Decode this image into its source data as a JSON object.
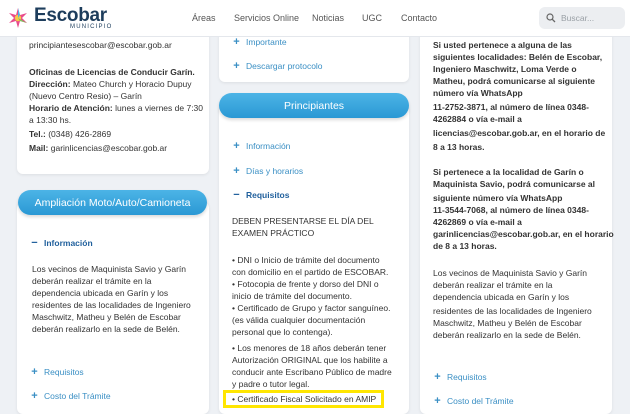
{
  "header": {
    "logo_name": "Escobar",
    "logo_sub": "MUNICIPIO",
    "nav": [
      "Áreas",
      "Servicios Online",
      "Noticias",
      "UGC",
      "Contacto"
    ],
    "search_placeholder": "Buscar..."
  },
  "left_card_top": {
    "email_partial": "principiantesescobar@escobar.gob.ar",
    "office_title": "Oficinas de Licencias de Conducir Garín.",
    "address_label": "Dirección:",
    "address_l1": " Mateo Church y Horacio Dupuy",
    "address_l2": "(Nuevo Centro Resio) – Garín",
    "hours_label": "Horario de Atención:",
    "hours_l1": " lunes a viernes de 7:30",
    "hours_l2": "a 13:30 hs.",
    "phone_label": "Tel.:",
    "phone": " (0348) 426-2869",
    "mail_label": "Mail:",
    "mail": " garinlicencias@escobar.gob.ar"
  },
  "ampliacion": {
    "title": "Ampliación Moto/Auto/Camioneta",
    "info_label": "Información",
    "info_text": [
      "Los vecinos de Maquinista Savio y Garín",
      "deberán realizar el trámite en la",
      "dependencia ubicada en Garín y los",
      "residentes de las localidades de Ingeniero",
      "Maschwitz, Matheu y Belén de Escobar",
      "deberán realizarlo en la sede de Belén."
    ],
    "requisitos_label": "Requisitos",
    "costo_label": "Costo del Trámite"
  },
  "middle_top": {
    "importante_label": "Importante",
    "descargar_label": "Descargar protocolo"
  },
  "principiantes": {
    "title": "Principiantes",
    "info_label": "Información",
    "dias_label": "Días y horarios",
    "requisitos_label": "Requisitos",
    "heading_l1": "DEBEN PRESENTARSE EL DÍA DEL",
    "heading_l2": "EXAMEN PRÁCTICO",
    "items": [
      "• DNI o Inicio de trámite del documento",
      "con domicilio en el partido de ESCOBAR.",
      "• Fotocopia de frente y dorso del DNI o",
      "inicio de trámite del documento.",
      "• Certificado de Grupo y factor sanguíneo.",
      "(es válida cualquier documentación",
      "personal que lo contenga).",
      "• Los menores de 18 años deberán tener",
      "Autorización ORIGINAL que los habilite a",
      "conducir ante Escribano Público de madre",
      "y padre o tutor legal.",
      "• Certificado Fiscal Solicitado en AMIP"
    ]
  },
  "right_card": {
    "para1": [
      "Si usted pertenece a alguna de las",
      "siguientes localidades: Belén de Escobar,",
      "Ingeniero Maschwitz, Loma Verde o",
      "Matheu, podrá comunicarse al siguiente",
      "número vía WhatsApp",
      "11-2752-3871, al número de línea 0348-",
      "4262884 o vía e-mail a",
      "licencias@escobar.gob.ar, en el horario de",
      "8 a 13 horas."
    ],
    "para2": [
      "Si pertenece a la localidad de Garín o",
      "Maquinista Savio, podrá comunicarse al",
      "siguiente número vía WhatsApp",
      "11-3544-7068, al número de línea 0348-",
      "4262869 o vía e-mail a",
      "garinlicencias@escobar.gob.ar, en el horario",
      "de 8 a 13 horas."
    ],
    "para3": [
      "Los vecinos de Maquinista Savio y Garín",
      "deberán realizar el trámite en la",
      "dependencia ubicada en Garín y los",
      "residentes de las localidades de Ingeniero",
      "Maschwitz, Matheu y Belén de Escobar",
      "deberán realizarlo en la sede de Belén."
    ],
    "requisitos_label": "Requisitos",
    "costo_label": "Costo del Trámite"
  },
  "colors": {
    "accent": "#3a8fc4",
    "pill": "#2a98d4",
    "highlight": "#ffe600",
    "logo": "#1d3d5c"
  }
}
